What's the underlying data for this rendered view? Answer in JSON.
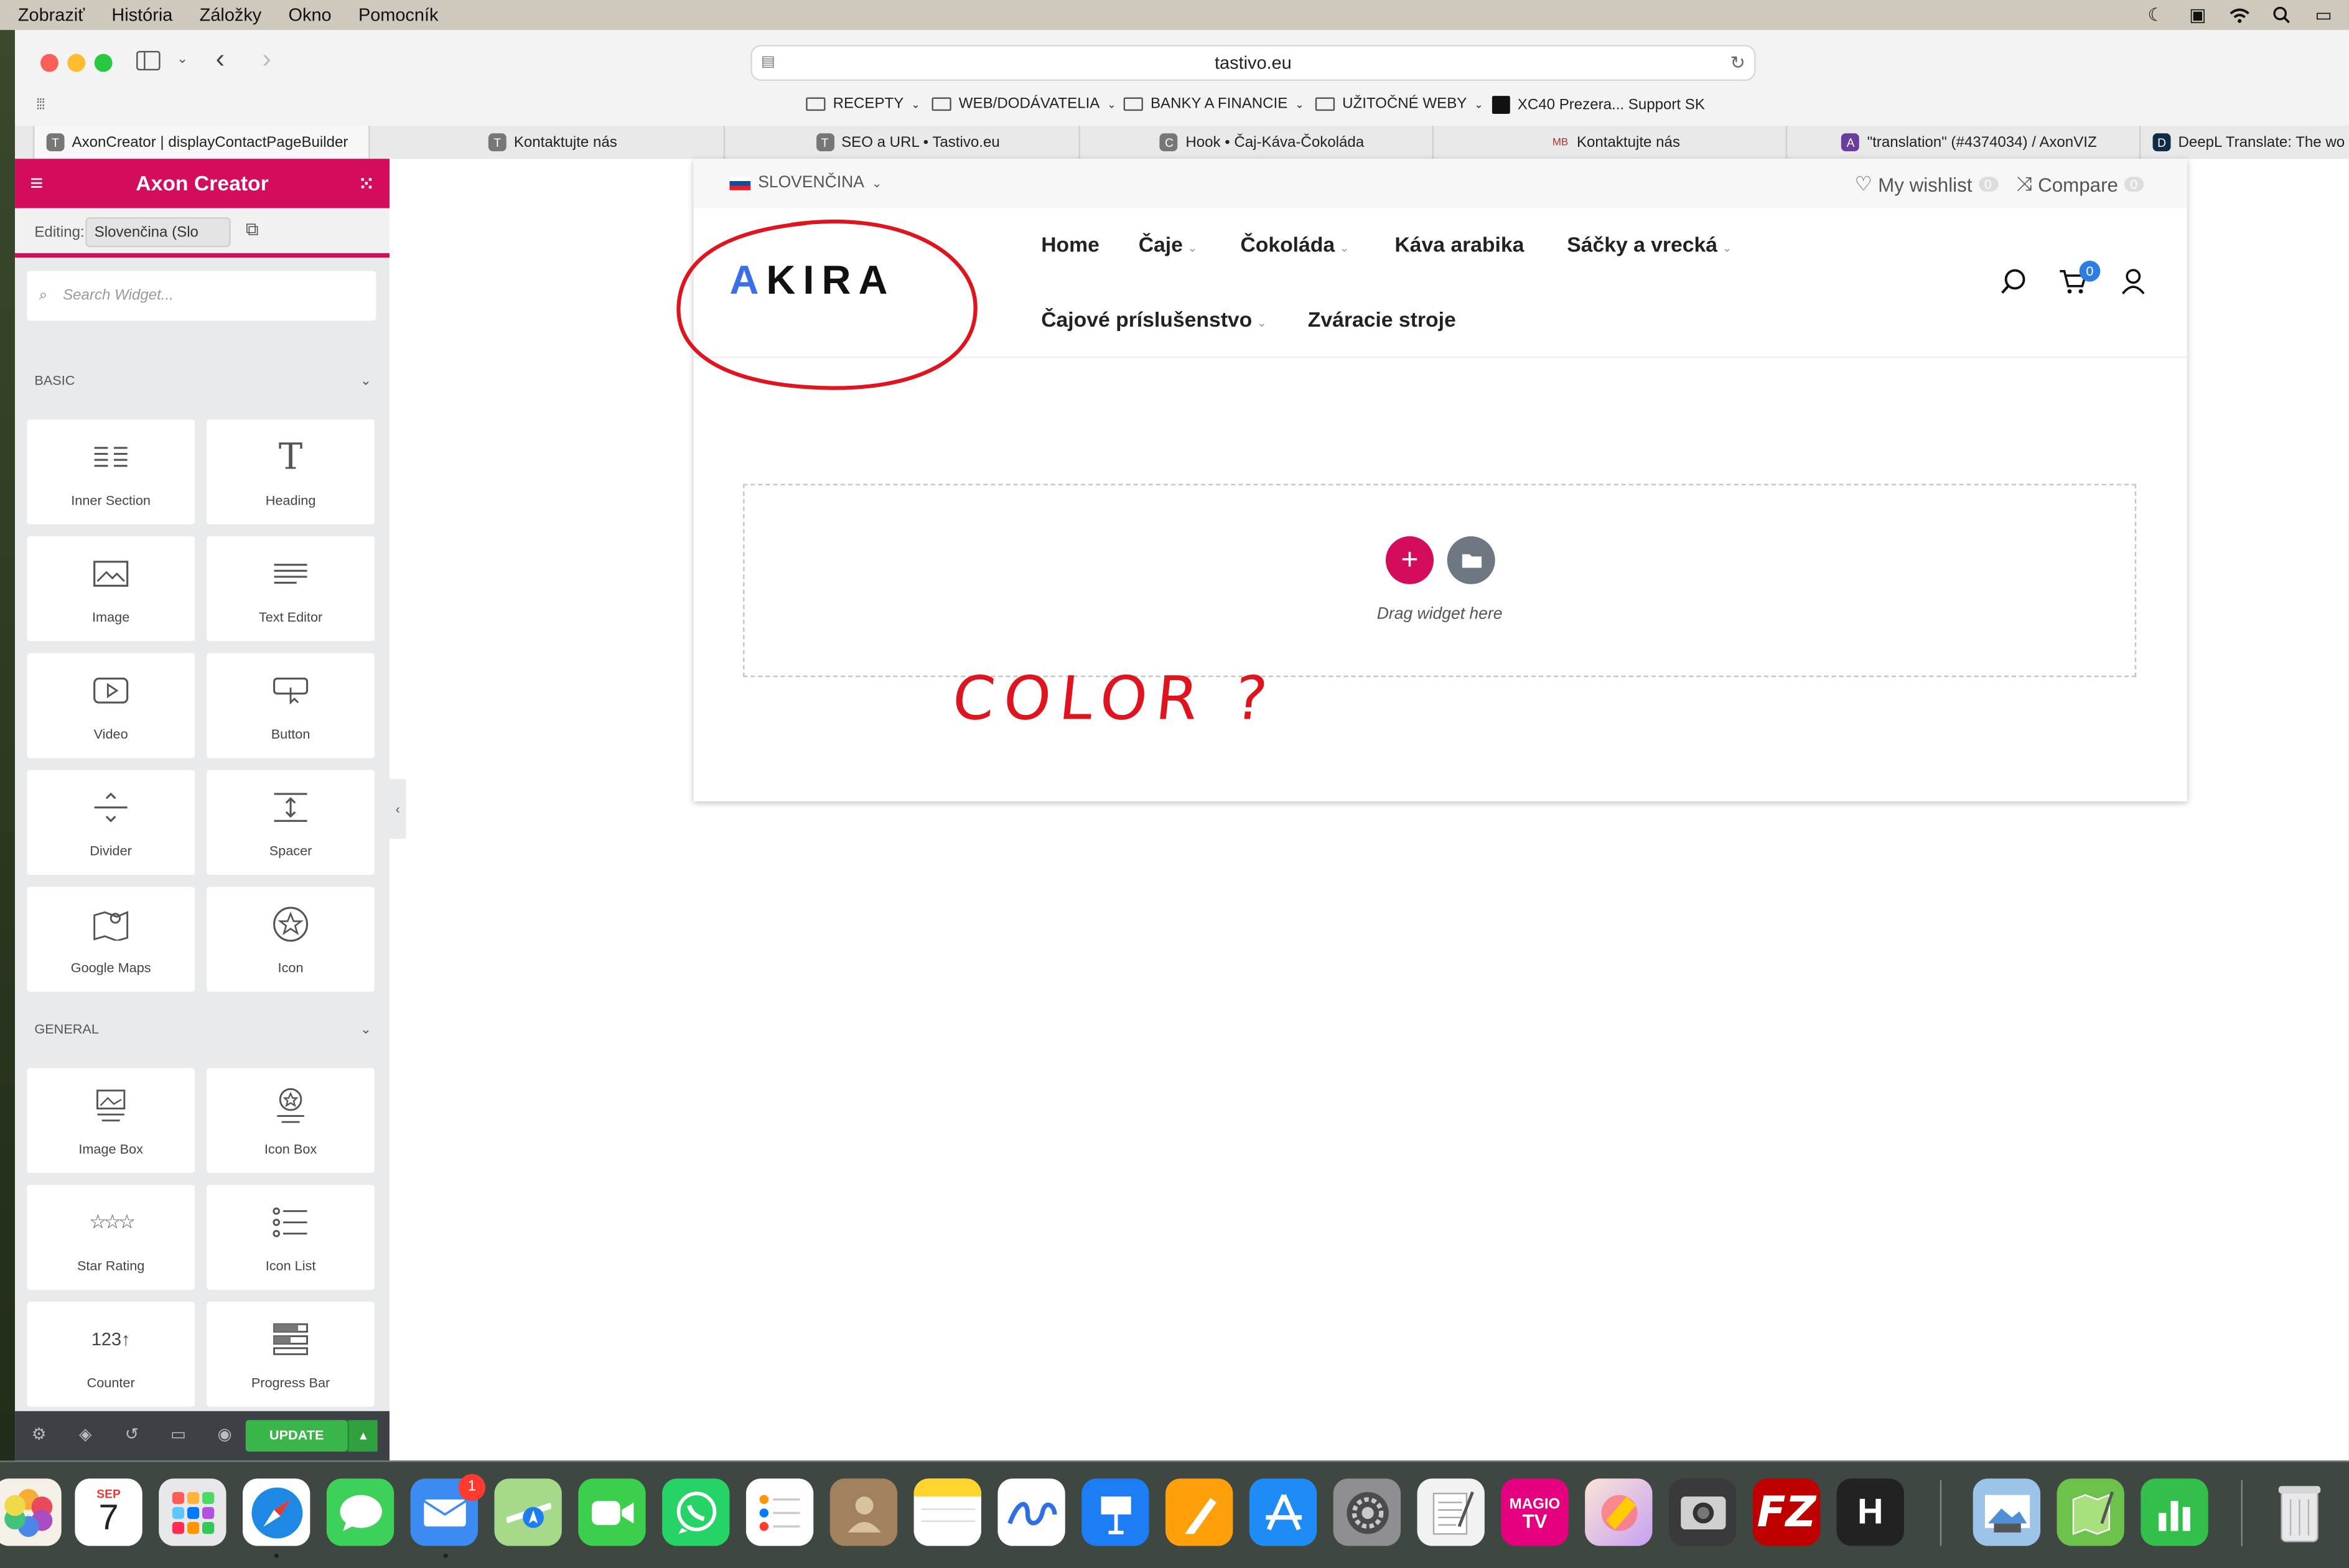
{
  "menubar": {
    "items": [
      "Zobraziť",
      "História",
      "Záložky",
      "Okno",
      "Pomocník"
    ]
  },
  "browser": {
    "url": "tastivo.eu",
    "bookmarks": [
      {
        "label": "RECEPTY"
      },
      {
        "label": "WEB/DODÁVATELIA"
      },
      {
        "label": "BANKY A FINANCIE"
      },
      {
        "label": "UŽITOČNÉ WEBY"
      },
      {
        "label": "XC40 Prezera... Support SK"
      }
    ],
    "tabs": [
      {
        "label": "AxonCreator | displayContactPageBuilder",
        "favicon": "T"
      },
      {
        "label": "Kontaktujte nás",
        "favicon": "T"
      },
      {
        "label": "SEO a URL • Tastivo.eu",
        "favicon": "T"
      },
      {
        "label": "Hook • Čaj-Káva-Čokoláda",
        "favicon": "C"
      },
      {
        "label": "Kontaktujte nás",
        "favicon": "MB"
      },
      {
        "label": "\"translation\" (#4374034) / AxonVIZ",
        "favicon": "A"
      },
      {
        "label": "DeepL Translate: The wo",
        "favicon": "D"
      }
    ]
  },
  "sidebar": {
    "title": "Axon Creator",
    "editing_label": "Editing:",
    "language_value": "Slovenčina (Slo",
    "search_placeholder": "Search Widget...",
    "categories": {
      "basic": "BASIC",
      "general": "GENERAL"
    },
    "basic_widgets": [
      {
        "label": "Inner Section",
        "icon": "inner-section-icon"
      },
      {
        "label": "Heading",
        "icon": "heading-icon"
      },
      {
        "label": "Image",
        "icon": "image-icon"
      },
      {
        "label": "Text Editor",
        "icon": "text-editor-icon"
      },
      {
        "label": "Video",
        "icon": "video-icon"
      },
      {
        "label": "Button",
        "icon": "button-icon"
      },
      {
        "label": "Divider",
        "icon": "divider-icon"
      },
      {
        "label": "Spacer",
        "icon": "spacer-icon"
      },
      {
        "label": "Google Maps",
        "icon": "google-maps-icon"
      },
      {
        "label": "Icon",
        "icon": "star-circle-icon"
      }
    ],
    "general_widgets": [
      {
        "label": "Image Box",
        "icon": "image-box-icon"
      },
      {
        "label": "Icon Box",
        "icon": "icon-box-icon"
      },
      {
        "label": "Star Rating",
        "icon": "star-rating-icon"
      },
      {
        "label": "Icon List",
        "icon": "icon-list-icon"
      },
      {
        "label": "Counter",
        "icon": "counter-icon"
      },
      {
        "label": "Progress Bar",
        "icon": "progress-bar-icon"
      }
    ],
    "update_label": "UPDATE"
  },
  "site": {
    "language": "SLOVENČINA",
    "wishlist_label": "My wishlist",
    "wishlist_count": "0",
    "compare_label": "Compare",
    "compare_count": "0",
    "logo_first": "A",
    "logo_rest": "KIRA",
    "nav": [
      {
        "label": "Home",
        "has_dropdown": false
      },
      {
        "label": "Čaje",
        "has_dropdown": true
      },
      {
        "label": "Čokoláda",
        "has_dropdown": true
      },
      {
        "label": "Káva arabika",
        "has_dropdown": false
      },
      {
        "label": "Sáčky a vrecká",
        "has_dropdown": true
      },
      {
        "label": "Čajové príslušenstvo",
        "has_dropdown": true
      },
      {
        "label": "Zváracie stroje",
        "has_dropdown": false
      }
    ],
    "cart_count": "0",
    "drop_zone_text": "Drag widget here"
  },
  "annotation": {
    "text": "COLOR ?",
    "color": "#e0141e"
  },
  "dock": {
    "calendar_month": "SEP",
    "calendar_day": "7",
    "mail_badge": "1"
  },
  "colors": {
    "accent": "#d30c5c",
    "update": "#39b54a",
    "logo_blue": "#3a6fe8"
  }
}
